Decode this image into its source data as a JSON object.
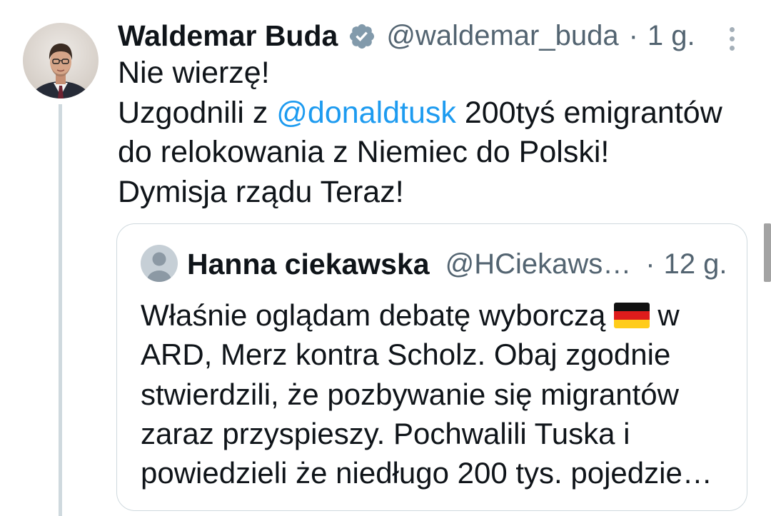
{
  "tweet": {
    "avatar_icon": "profile-photo",
    "author": {
      "name": "Waldemar Buda",
      "verified_icon": "verified-badge-icon",
      "handle": "@waldemar_buda",
      "separator": "·",
      "time": "1 g."
    },
    "menu_icon": "more-vertical-icon",
    "body": {
      "line1": "Nie wierzę!",
      "line2_before": "Uzgodnili z ",
      "mention": "@donaldtusk",
      "line2_after": " 200tyś emigrantów",
      "line3": "do relokowania z Niemiec do Polski!",
      "line4": "Dymisja rządu Teraz!"
    }
  },
  "quote": {
    "author": {
      "avatar_icon": "default-avatar-icon",
      "name": "Hanna ciekawska",
      "handle": "@HCiekaws…",
      "separator": "·",
      "time": "12 g."
    },
    "body": {
      "line1_before_flag": "Właśnie oglądam debatę wyborczą",
      "flag_icon": "germany-flag-icon",
      "line1_after_flag": "w",
      "line2": "ARD, Merz kontra Scholz. Obaj zgodnie",
      "line3": "stwierdzili, że pozbywanie się migrantów",
      "line4": "zaraz przyspieszy. Pochwalili Tuska i",
      "line5": "powiedzieli że niedługo 200 tys. pojedzie…"
    }
  },
  "colors": {
    "text": "#0f1419",
    "secondary_text": "#536471",
    "link": "#1d9bf0",
    "border": "#cfd9de",
    "verified_badge": "#829aab"
  }
}
